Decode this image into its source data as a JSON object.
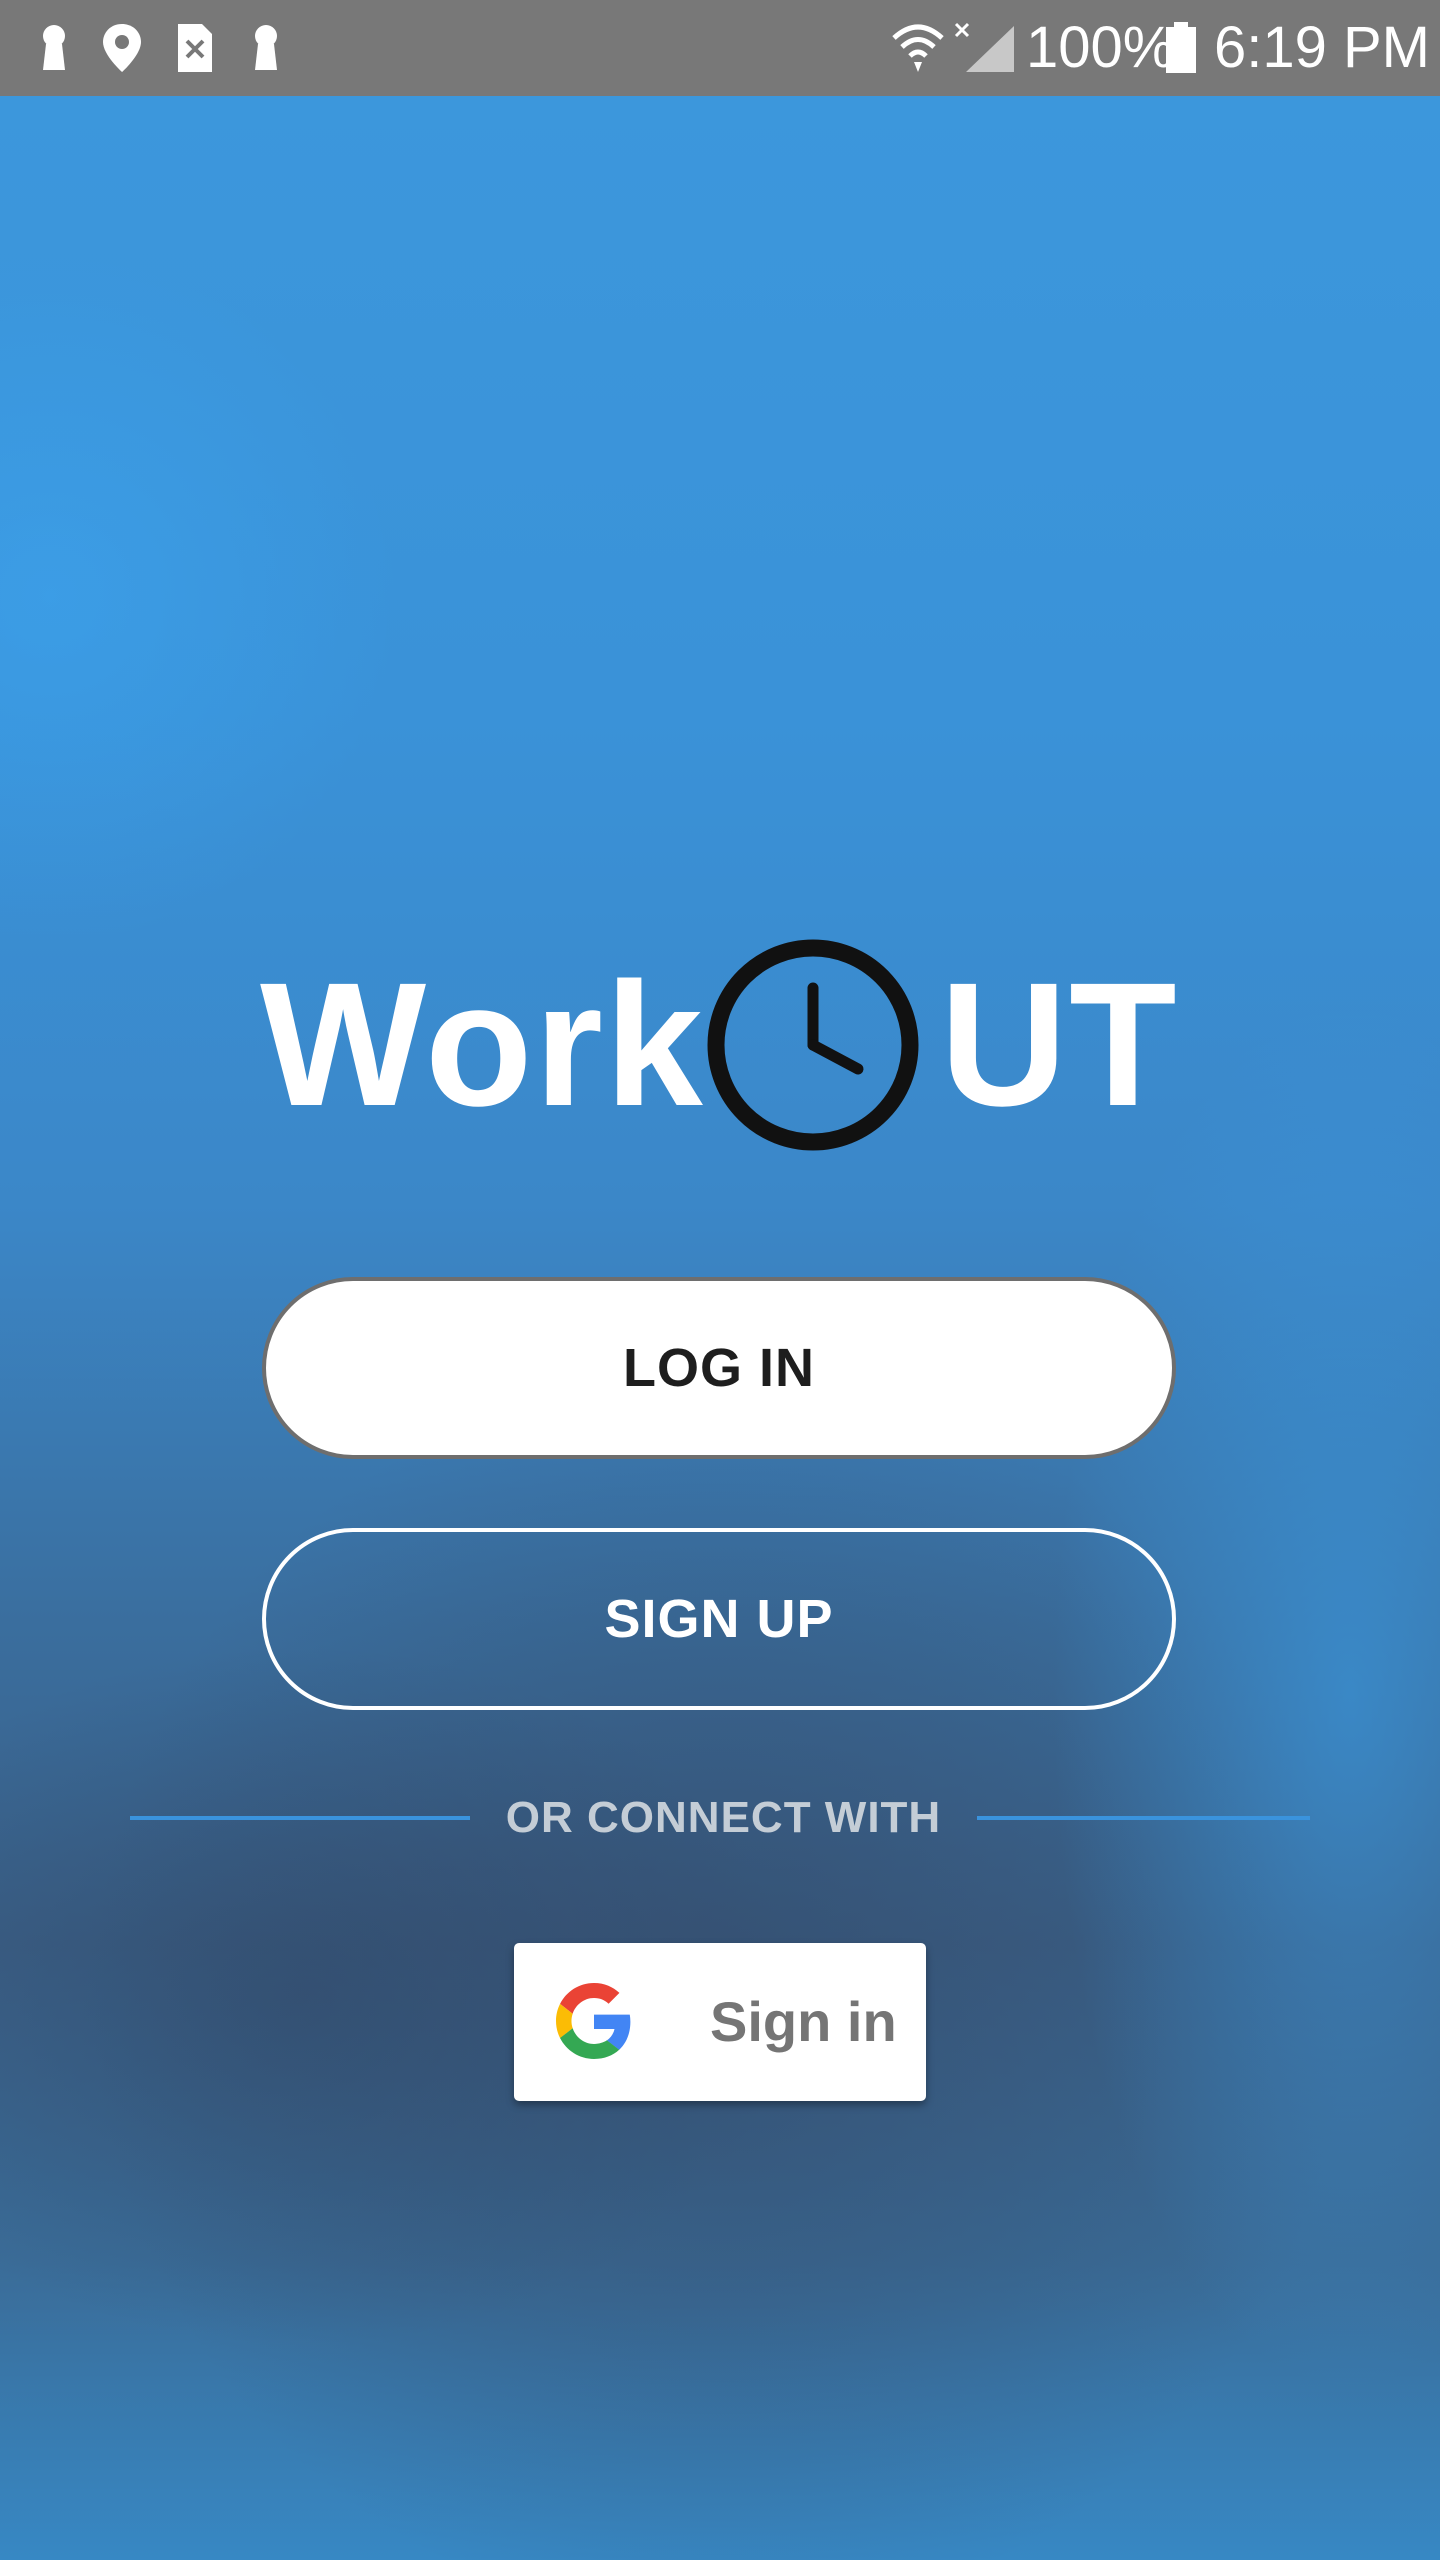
{
  "status_bar": {
    "battery": "100%",
    "time": "6:19 PM",
    "left_icons": [
      "keyhole-icon",
      "location-pin-icon",
      "sim-error-icon",
      "keyhole-icon"
    ],
    "right_icons": [
      "wifi-icon",
      "no-signal-icon",
      "battery-icon"
    ]
  },
  "logo": {
    "text_left": "Work",
    "icon": "clock-icon",
    "text_right": "UT"
  },
  "buttons": {
    "login": "LOG IN",
    "signup": "SIGN UP"
  },
  "divider": {
    "text": "OR CONNECT WITH"
  },
  "google": {
    "label": "Sign in",
    "icon": "google-g-icon"
  },
  "colors": {
    "status_bar": "#787878",
    "background_top": "#3c97dc",
    "background_mid": "#3a5f86",
    "divider_line": "#3a93dd",
    "divider_text": "#c4cdd6",
    "login_text": "#1e1e1e",
    "google_label": "#757575"
  }
}
